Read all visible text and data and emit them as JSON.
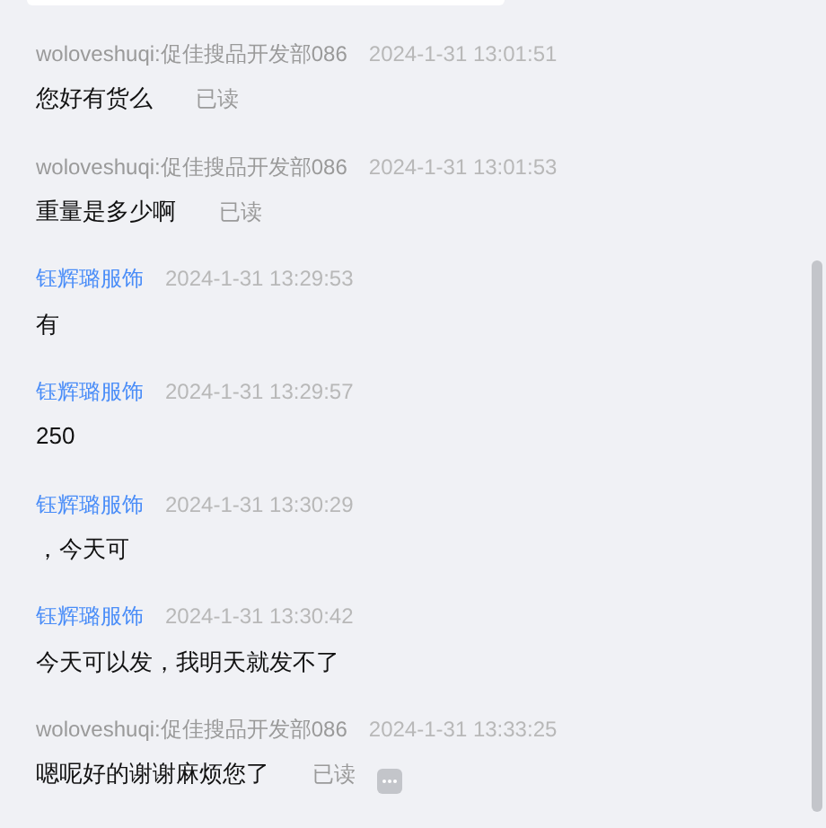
{
  "messages": [
    {
      "kind": "buyer",
      "sender": "woloveshuqi:促佳搜品开发部086",
      "time": "2024-1-31 13:01:51",
      "text": "您好有货么",
      "status": "已读"
    },
    {
      "kind": "buyer",
      "sender": "woloveshuqi:促佳搜品开发部086",
      "time": "2024-1-31 13:01:53",
      "text": "重量是多少啊",
      "status": "已读"
    },
    {
      "kind": "seller",
      "sender": "钰辉璐服饰",
      "time": "2024-1-31 13:29:53",
      "text": "有"
    },
    {
      "kind": "seller",
      "sender": "钰辉璐服饰",
      "time": "2024-1-31 13:29:57",
      "text": "250"
    },
    {
      "kind": "seller",
      "sender": "钰辉璐服饰",
      "time": "2024-1-31 13:30:29",
      "text": "，今天可"
    },
    {
      "kind": "seller",
      "sender": "钰辉璐服饰",
      "time": "2024-1-31 13:30:42",
      "text": "今天可以发，我明天就发不了"
    },
    {
      "kind": "buyer",
      "sender": "woloveshuqi:促佳搜品开发部086",
      "time": "2024-1-31 13:33:25",
      "text": "嗯呢好的谢谢麻烦您了",
      "status": "已读",
      "more": true
    }
  ]
}
